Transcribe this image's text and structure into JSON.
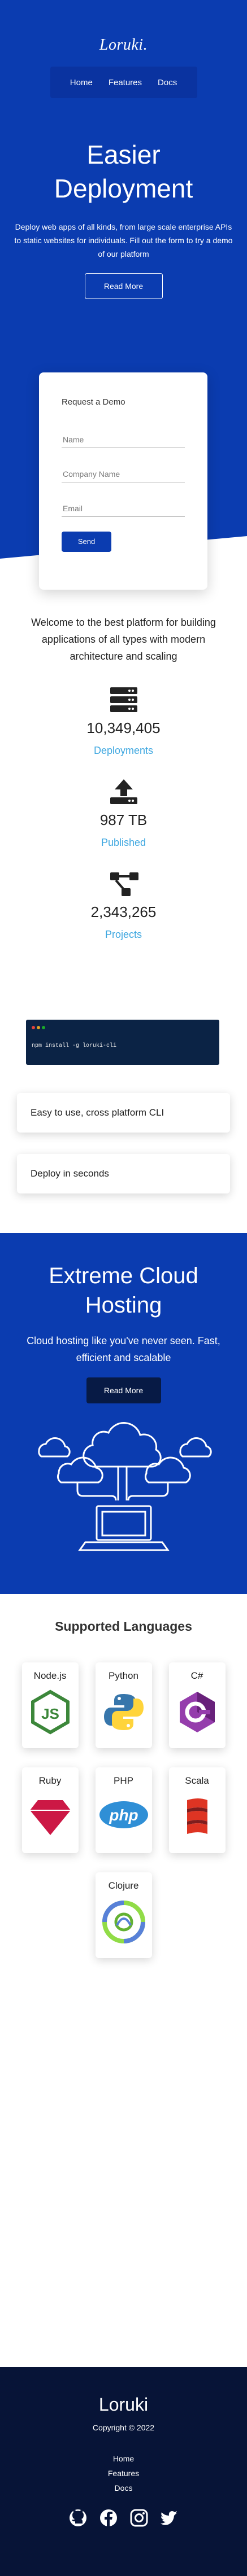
{
  "header": {
    "logo": "Loruki.",
    "nav": [
      "Home",
      "Features",
      "Docs"
    ]
  },
  "hero": {
    "title": "Easier Deployment",
    "description": "Deploy web apps of all kinds, from large scale enterprise APIs to static websites for individuals. Fill out the form to try a demo of our platform",
    "button": "Read More"
  },
  "demo_form": {
    "title": "Request a Demo",
    "name_placeholder": "Name",
    "company_placeholder": "Company Name",
    "email_placeholder": "Email",
    "send": "Send"
  },
  "welcome": "Welcome to the best platform for building applications of all types with modern architecture and scaling",
  "stats": [
    {
      "icon": "server-icon",
      "value": "10,349,405",
      "label": "Deployments"
    },
    {
      "icon": "upload-icon",
      "value": "987 TB",
      "label": "Published"
    },
    {
      "icon": "project-diagram-icon",
      "value": "2,343,265",
      "label": "Projects"
    }
  ],
  "terminal": {
    "command": "npm install -g loruki-cli"
  },
  "features": [
    "Easy to use, cross platform CLI",
    "Deploy in seconds"
  ],
  "cloud": {
    "title": "Extreme Cloud Hosting",
    "description": "Cloud hosting like you've never seen. Fast, efficient and scalable",
    "button": "Read More"
  },
  "languages": {
    "title": "Supported Languages",
    "items": [
      {
        "name": "Node.js",
        "icon": "nodejs-logo"
      },
      {
        "name": "Python",
        "icon": "python-logo"
      },
      {
        "name": "C#",
        "icon": "csharp-logo"
      },
      {
        "name": "Ruby",
        "icon": "ruby-logo"
      },
      {
        "name": "PHP",
        "icon": "php-logo"
      },
      {
        "name": "Scala",
        "icon": "scala-logo"
      },
      {
        "name": "Clojure",
        "icon": "clojure-logo"
      }
    ]
  },
  "footer": {
    "logo": "Loruki",
    "copyright": "Copyright © 2022",
    "links": [
      "Home",
      "Features",
      "Docs"
    ],
    "social": [
      "github-icon",
      "facebook-icon",
      "instagram-icon",
      "twitter-icon"
    ]
  },
  "colors": {
    "primary": "#0b3cb0",
    "dark": "#071437",
    "accent": "#3ea7e0"
  }
}
